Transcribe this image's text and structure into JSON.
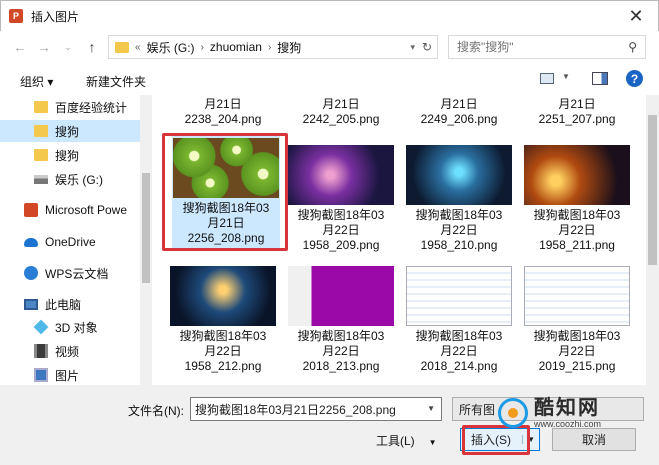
{
  "window": {
    "title": "插入图片",
    "close_glyph": "✕"
  },
  "nav": {
    "back": "←",
    "forward": "→",
    "recent": "⌄",
    "up": "↑"
  },
  "address": {
    "prefix": "«",
    "crumbs": [
      "娱乐 (G:)",
      "zhuomian",
      "搜狗"
    ],
    "separator": "›",
    "refresh": "↻"
  },
  "search": {
    "placeholder": "搜索\"搜狗\""
  },
  "toolbar": {
    "organize": "组织 ▾",
    "new_folder": "新建文件夹",
    "help": "?"
  },
  "sidebar": {
    "items": [
      {
        "label": "百度经验统计",
        "icon": "folder-icon"
      },
      {
        "label": "搜狗",
        "icon": "folder-icon",
        "selected": true
      },
      {
        "label": "搜狗",
        "icon": "folder-icon"
      },
      {
        "label": "娱乐 (G:)",
        "icon": "drive-icon"
      },
      {
        "label": "Microsoft Powe",
        "icon": "powerpoint-icon"
      },
      {
        "label": "OneDrive",
        "icon": "onedrive-icon"
      },
      {
        "label": "WPS云文档",
        "icon": "wps-cloud-icon"
      },
      {
        "label": "此电脑",
        "icon": "computer-icon"
      },
      {
        "label": "3D 对象",
        "icon": "3d-objects-icon"
      },
      {
        "label": "视频",
        "icon": "video-icon"
      },
      {
        "label": "图片",
        "icon": "pictures-icon"
      }
    ]
  },
  "files": [
    {
      "line1": "月21日",
      "line2": "2238_204.png"
    },
    {
      "line1": "月21日",
      "line2": "2242_205.png"
    },
    {
      "line1": "月21日",
      "line2": "2249_206.png"
    },
    {
      "line1": "月21日",
      "line2": "2251_207.png"
    },
    {
      "line1": "搜狗截图18年03",
      "line2": "月21日",
      "line3": "2256_208.png",
      "selected": true
    },
    {
      "line1": "搜狗截图18年03",
      "line2": "月22日",
      "line3": "1958_209.png"
    },
    {
      "line1": "搜狗截图18年03",
      "line2": "月22日",
      "line3": "1958_210.png"
    },
    {
      "line1": "搜狗截图18年03",
      "line2": "月22日",
      "line3": "1958_211.png"
    },
    {
      "line1": "搜狗截图18年03",
      "line2": "月22日",
      "line3": "1958_212.png"
    },
    {
      "line1": "搜狗截图18年03",
      "line2": "月22日",
      "line3": "2018_213.png"
    },
    {
      "line1": "搜狗截图18年03",
      "line2": "月22日",
      "line3": "2018_214.png"
    },
    {
      "line1": "搜狗截图18年03",
      "line2": "月22日",
      "line3": "2019_215.png"
    }
  ],
  "bottom": {
    "filename_label": "文件名(N):",
    "filename_value": "搜狗截图18年03月21日2256_208.png",
    "filter": "所有图",
    "tools": "工具(L)",
    "insert": "插入(S)",
    "cancel": "取消"
  },
  "watermark": {
    "brand": "酷知网",
    "url": "www.coozhi.com"
  },
  "colors": {
    "selection": "#cce8ff",
    "highlight_box": "#d8353b",
    "accent": "#0078d7"
  }
}
